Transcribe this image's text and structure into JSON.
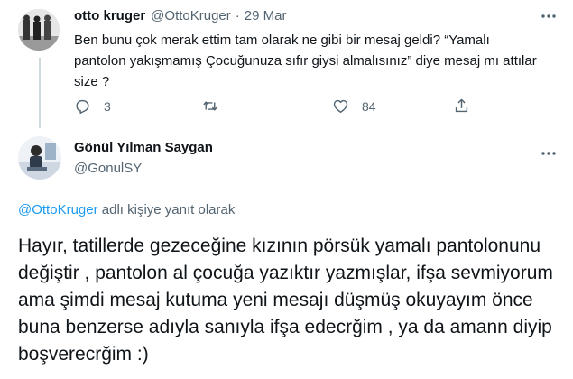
{
  "tweet1": {
    "name": "otto kruger",
    "handle": "@OttoKruger",
    "separator": "·",
    "date": "29 Mar",
    "text": "Ben bunu çok merak ettim tam olarak ne gibi bir mesaj geldi? “Yamalı pantolon yakışmamış Çocuğunuza sıfır giysi almalısınız” diye mesaj mı attılar size ?",
    "actions": {
      "reply_count": "3",
      "retweet_count": "",
      "like_count": "84"
    }
  },
  "tweet2": {
    "name": "Gönül Yılman Saygan",
    "handle": "@GonulSY",
    "reply_to_handle": "@OttoKruger",
    "reply_to_suffix": " adlı kişiye yanıt olarak",
    "text": "Hayır,  tatillerde gezeceğine kızının pörsük yamalı pantolonunu değiştir , pantolon al çocuğa yazıktır yazmışlar,  ifşa sevmiyorum ama şimdi mesaj kutuma yeni mesajı düşmüş okuyayım önce buna benzerse adıyla sanıyla ifşa edecrğim , ya da amann diyip boşverecrğim :)"
  },
  "colors": {
    "link": "#1d9bf0",
    "muted": "#536471",
    "text": "#0f1419"
  },
  "icons": [
    "more-icon",
    "reply-icon",
    "retweet-icon",
    "like-icon",
    "share-icon"
  ]
}
